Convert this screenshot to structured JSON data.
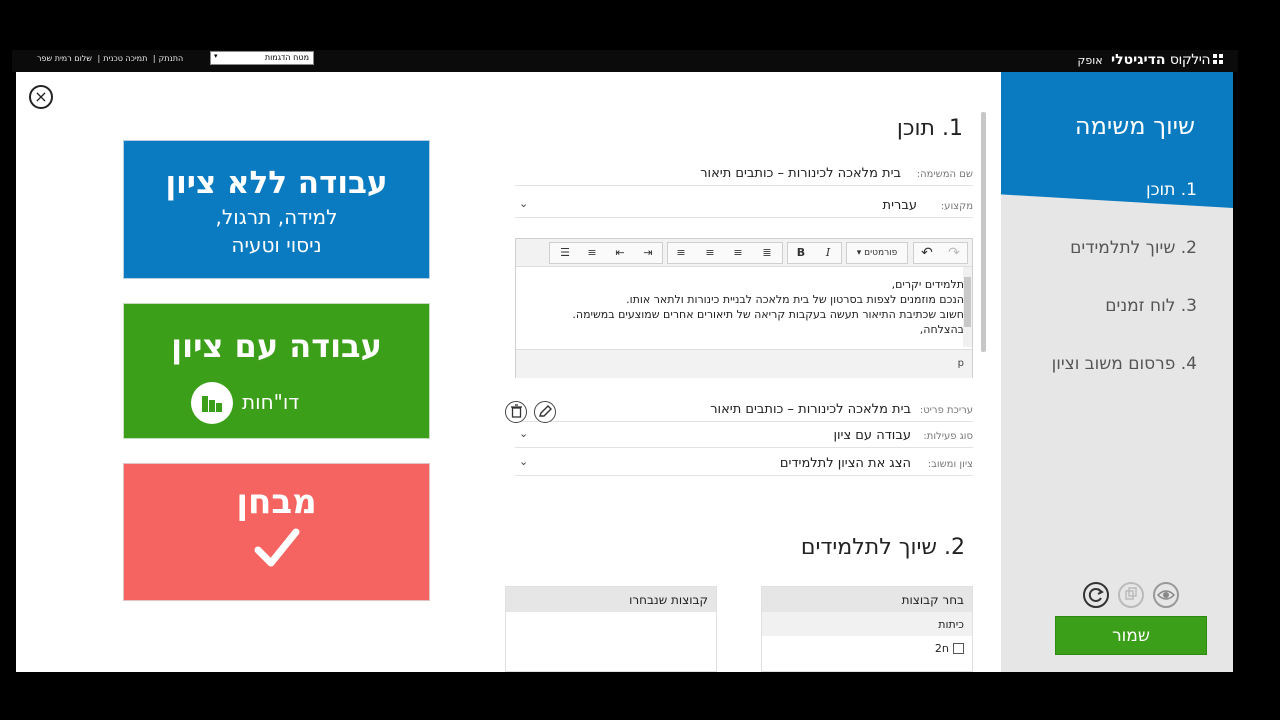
{
  "topbar": {
    "brand_part1": "הילקוס",
    "brand_part2": "הדיגיטלי",
    "brand_part3": "אופק",
    "select_value": "מטח הדגמות",
    "user_greeting": "שלום רמית שפר",
    "support_link": "תמיכה טכנית",
    "logout_link": "התנתק"
  },
  "tiles": {
    "no_grade_title": "עבודה ללא ציון",
    "no_grade_line1": "למידה, תרגול,",
    "no_grade_line2": "ניסוי וטעיה",
    "with_grade_title": "עבודה עם ציון",
    "reports_label": "דו\"חות",
    "exam_title": "מבחן"
  },
  "form": {
    "section1_title": "1. תוכן",
    "task_name_label": "שם המשימה:",
    "task_name_value": "בית מלאכה לכינורות – כותבים תיאור",
    "subject_label": "מקצוע:",
    "subject_value": "עברית",
    "formats_label": "פורמטים",
    "editor_lines": [
      "תלמידים יקרים,",
      "הנכם מוזמנים לצפות בסרטון של בית מלאכה לבניית כינורות ולתאר אותו.",
      "חשוב שכתיבת התיאור תעשה בעקבות קריאה של תיאורים אחרים שמוצעים במשימה.",
      "בהצלחה,"
    ],
    "editor_path": "p",
    "item_edit_label": "עריכת פריט:",
    "item_edit_value": "בית מלאכה לכינורות – כותבים תיאור",
    "activity_type_label": "סוג פעילות:",
    "activity_type_value": "עבודה עם ציון",
    "grade_feedback_label": "ציון ומשוב:",
    "grade_feedback_value": "הצג את הציון לתלמידים",
    "section2_title": "2. שיוך לתלמידים",
    "choose_groups_header": "בחר קבוצות",
    "classes_label": "כיתות",
    "class_item": "ח2",
    "selected_groups_header": "קבוצות שנבחרו"
  },
  "sidebar": {
    "title": "שיוך משימה",
    "steps": [
      "1. תוכן",
      "2. שיוך לתלמידים",
      "3. לוח זמנים",
      "4. פרסום משוב וציון"
    ],
    "save_label": "שמור"
  },
  "colors": {
    "blue": "#0a7bc1",
    "green": "#3c9f1a",
    "red": "#f56460"
  }
}
